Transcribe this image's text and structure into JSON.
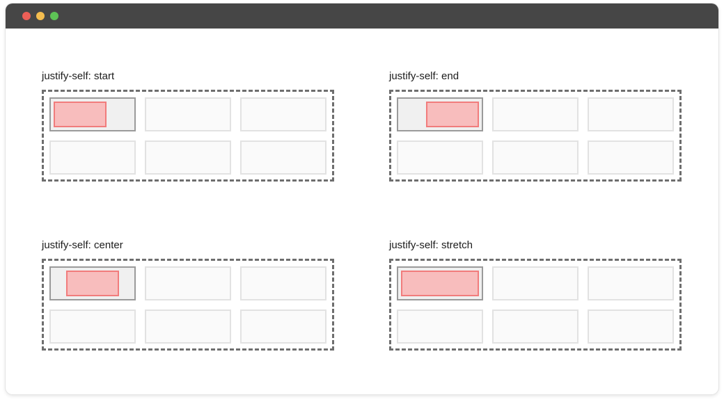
{
  "window": {
    "controls": [
      "close",
      "minimize",
      "maximize"
    ]
  },
  "demos": [
    {
      "label": "justify-self: start",
      "value": "start"
    },
    {
      "label": "justify-self: end",
      "value": "end"
    },
    {
      "label": "justify-self: center",
      "value": "center"
    },
    {
      "label": "justify-self: stretch",
      "value": "stretch"
    }
  ],
  "colors": {
    "titlebar": "#464646",
    "close": "#ec5f57",
    "minimize": "#f4bd4f",
    "maximize": "#5ec356",
    "item_fill": "#f8bdbd",
    "item_border": "#f17c7c",
    "grid_border": "#6e6e6e"
  }
}
